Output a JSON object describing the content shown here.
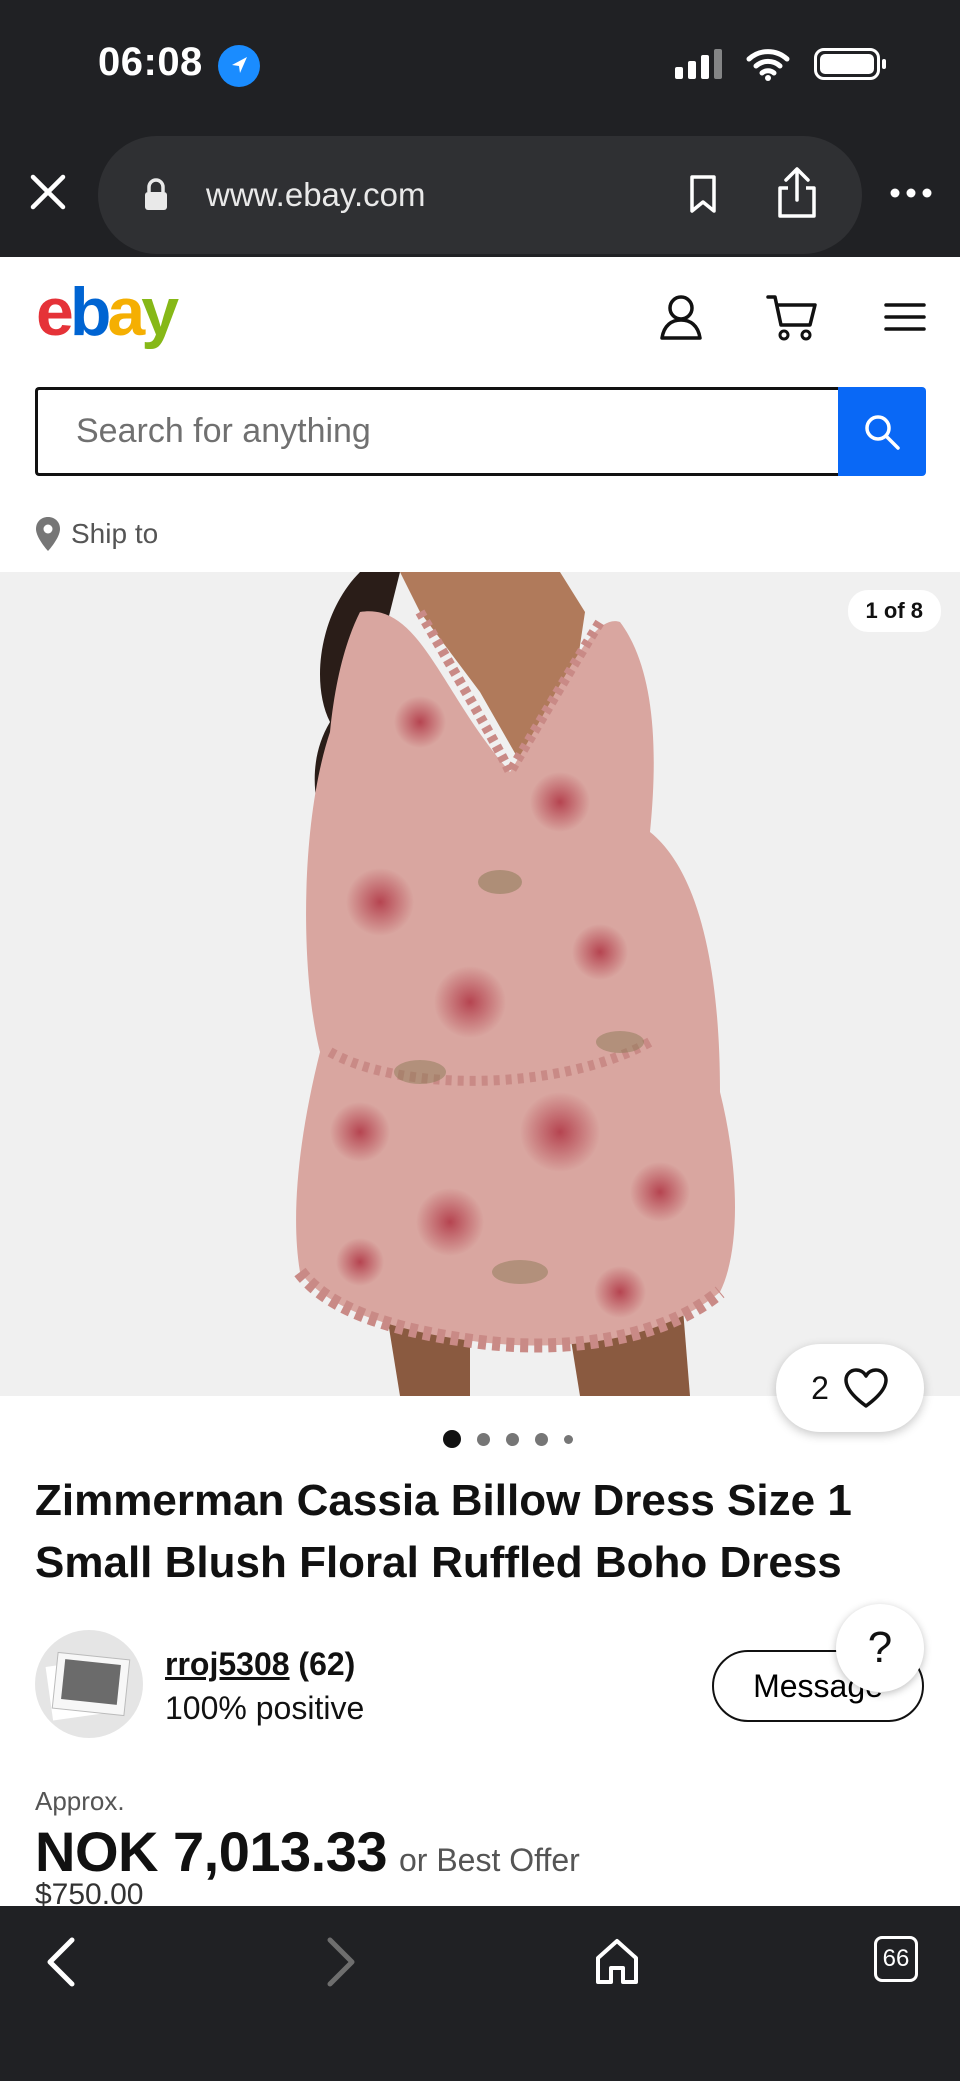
{
  "status_bar": {
    "time": "06:08"
  },
  "browser": {
    "url": "www.ebay.com",
    "tabs_count": "66"
  },
  "header": {
    "logo": {
      "e": "e",
      "b": "b",
      "a": "a",
      "y": "y"
    },
    "search_placeholder": "Search for anything",
    "ship_to": "Ship to"
  },
  "gallery": {
    "counter": "1 of 8",
    "watch_count": "2",
    "dot_count": 5,
    "active_dot": 0
  },
  "listing": {
    "title": "Zimmerman Cassia Billow Dress Size 1 Small Blush Floral Ruffled Boho Dress",
    "seller_name": "rroj5308",
    "seller_feedback": "(62)",
    "seller_positive": "100% positive",
    "message_label": "Message",
    "help_label": "?",
    "approx_label": "Approx.",
    "price": "NOK 7,013.33",
    "best_offer": "or Best Offer",
    "original_price": "$750.00"
  },
  "colors": {
    "ebay_red": "#e53238",
    "ebay_blue": "#0064d2",
    "ebay_yellow": "#f5af02",
    "ebay_green": "#86b817",
    "search_button": "#0968f6",
    "browser_chrome": "#202124"
  }
}
